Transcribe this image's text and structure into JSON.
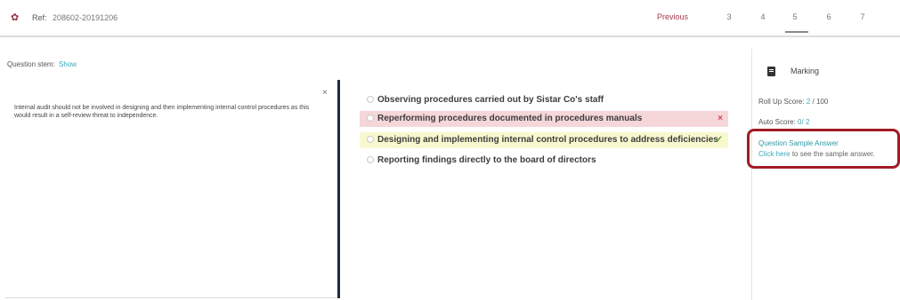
{
  "header": {
    "ref_label": "Ref:",
    "ref_value": "208602-20191206",
    "previous_label": "Previous",
    "pages": [
      "3",
      "4",
      "5",
      "6",
      "7"
    ],
    "current_page": "5",
    "gear_icon": "gear-icon"
  },
  "stem": {
    "label": "Question stem:",
    "show_link": "Show"
  },
  "left_panel": {
    "close_glyph": "×",
    "text": "Internal audit should not be involved in designing and then implementing internal control procedures as this would result in a self-review threat to independence."
  },
  "options": [
    {
      "text": "Observing procedures carried out by Sistar Co's staff",
      "state": "neutral",
      "mark": ""
    },
    {
      "text": "Reperforming procedures documented in procedures manuals",
      "state": "incorrect",
      "mark": "×"
    },
    {
      "text": "Designing and implementing internal control procedures to address deficiencies",
      "state": "correct",
      "mark": "✓"
    },
    {
      "text": "Reporting findings directly to the board of directors",
      "state": "neutral",
      "mark": ""
    }
  ],
  "marking": {
    "title": "Marking",
    "roll_up_label": "Roll Up Score:",
    "roll_up_value": "2",
    "roll_up_total": "/ 100",
    "auto_score_label": "Auto Score:",
    "auto_score_value": "0",
    "auto_score_total": "/ 2",
    "sample_answer_title": "Question Sample Answer",
    "sample_answer_link": "Click here",
    "sample_answer_suffix": "to see the sample answer."
  },
  "colors": {
    "accent_teal": "#3aa9b8",
    "brand_red": "#a33a4a",
    "divider_navy": "#1f2a44",
    "incorrect_bg": "#f5d6d9",
    "correct_bg": "#f8f8cf",
    "highlight_box": "#a01c24"
  }
}
